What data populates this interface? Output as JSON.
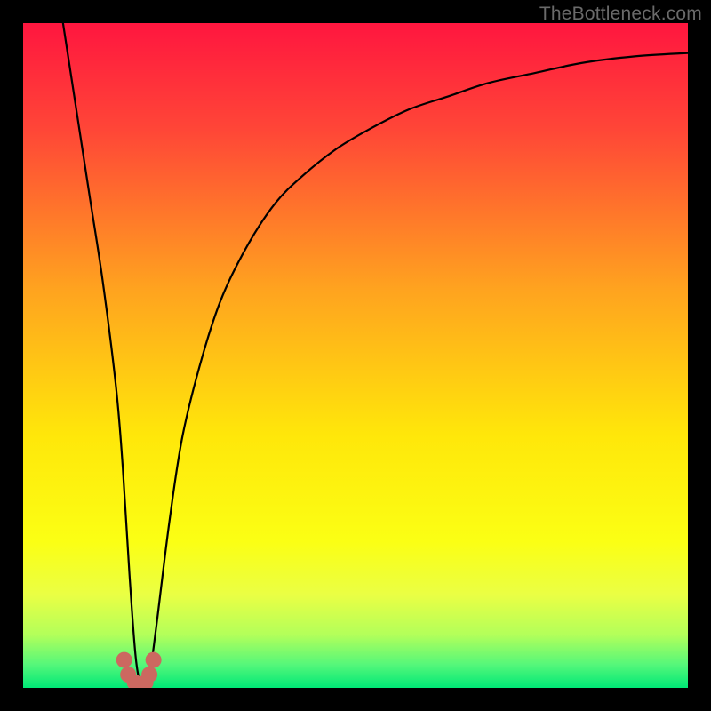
{
  "watermark": "TheBottleneck.com",
  "chart_data": {
    "type": "line",
    "title": "",
    "xlabel": "",
    "ylabel": "",
    "xlim": [
      0,
      100
    ],
    "ylim": [
      0,
      100
    ],
    "gradient_stops": [
      {
        "offset": 0.0,
        "color": "#ff163f"
      },
      {
        "offset": 0.16,
        "color": "#ff4637"
      },
      {
        "offset": 0.4,
        "color": "#ffa31f"
      },
      {
        "offset": 0.62,
        "color": "#ffe70a"
      },
      {
        "offset": 0.78,
        "color": "#fbff14"
      },
      {
        "offset": 0.86,
        "color": "#eaff44"
      },
      {
        "offset": 0.92,
        "color": "#b3ff5a"
      },
      {
        "offset": 0.965,
        "color": "#55f77a"
      },
      {
        "offset": 1.0,
        "color": "#00e876"
      }
    ],
    "series": [
      {
        "name": "bottleneck-curve",
        "x": [
          6,
          8,
          10,
          12,
          14,
          15,
          16,
          17,
          18,
          19,
          20,
          22,
          24,
          27,
          30,
          34,
          38,
          42,
          47,
          52,
          58,
          64,
          70,
          77,
          84,
          92,
          100
        ],
        "y": [
          100,
          87,
          74,
          61,
          45,
          33,
          17,
          4,
          0,
          2,
          9,
          25,
          38,
          50,
          59,
          67,
          73,
          77,
          81,
          84,
          87,
          89,
          91,
          92.5,
          94,
          95,
          95.5
        ]
      }
    ],
    "markers": {
      "name": "highlight-cluster",
      "color": "#cc6860",
      "points": [
        {
          "x": 15.2,
          "y": 4.2
        },
        {
          "x": 15.8,
          "y": 2.0
        },
        {
          "x": 16.8,
          "y": 0.8
        },
        {
          "x": 17.6,
          "y": 0.5
        },
        {
          "x": 18.4,
          "y": 0.8
        },
        {
          "x": 19.0,
          "y": 2.0
        },
        {
          "x": 19.6,
          "y": 4.2
        }
      ]
    }
  }
}
